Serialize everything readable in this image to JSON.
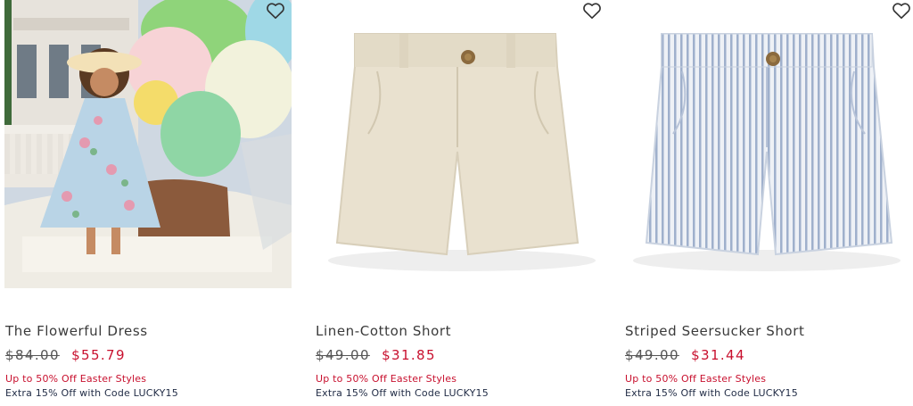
{
  "products": [
    {
      "name": "The Flowerful Dress",
      "original_price": "$84.00",
      "sale_price": "$55.79",
      "promo_line": "Up to 50% Off Easter Styles",
      "code_line": "Extra 15% Off with Code LUCKY15",
      "favorite_icon": "heart-outline-icon"
    },
    {
      "name": "Linen-Cotton Short",
      "original_price": "$49.00",
      "sale_price": "$31.85",
      "promo_line": "Up to 50% Off Easter Styles",
      "code_line": "Extra 15% Off with Code LUCKY15",
      "favorite_icon": "heart-outline-icon"
    },
    {
      "name": "Striped Seersucker Short",
      "original_price": "$49.00",
      "sale_price": "$31.44",
      "promo_line": "Up to 50% Off Easter Styles",
      "code_line": "Extra 15% Off with Code LUCKY15",
      "favorite_icon": "heart-outline-icon"
    }
  ],
  "colors": {
    "sale_price": "#c8102e",
    "promo_text": "#c8102e",
    "code_text": "#1f2a44",
    "name_text": "#3a3a3a"
  }
}
